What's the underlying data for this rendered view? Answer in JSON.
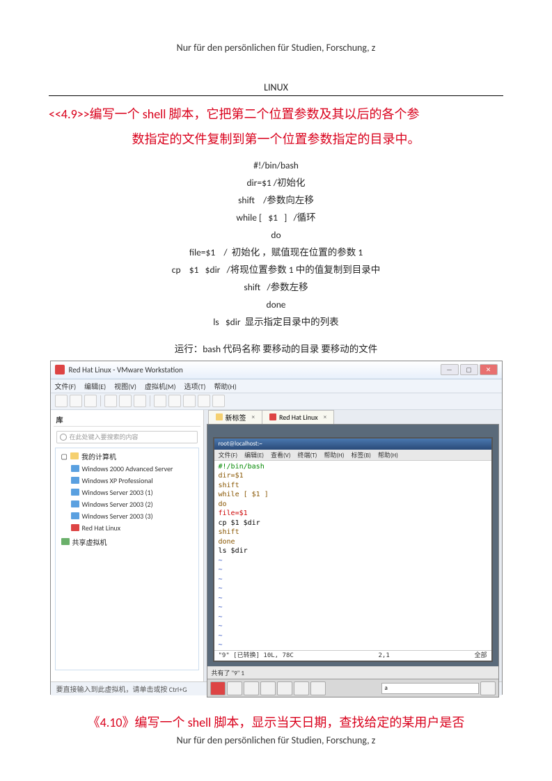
{
  "header": "Nur für den persönlichen für Studien, Forschung, z",
  "section_title": "LINUX",
  "q49_heading_l1": "<<4.9>>编写一个 shell 脚本，它把第二个位置参数及其以后的各个参",
  "q49_heading_l2": "数指定的文件复制到第一个位置参数指定的目录中。",
  "code": {
    "l1": "#!/bin/bash",
    "l2": "dir=$1 /初始化",
    "l3": "shift    /参数向左移",
    "l4": "while [   $1   ]   /循环",
    "l5": "do",
    "l6": "file=$1    /  初始化 ，赋值现在位置的参数 1",
    "l7": "cp    $1   $dir   /将现位置参数 1 中的值复制到目录中",
    "l8": "shift   /参数左移",
    "l9": "done",
    "l10": "ls   $dir  显示指定目录中的列表"
  },
  "run_line": "运行：bash  代码名称    要移动的目录    要移动的文件",
  "vm": {
    "title": "Red Hat Linux - VMware Workstation",
    "menus": [
      "文件(F)",
      "编辑(E)",
      "视图(V)",
      "虚拟机(M)",
      "选项(T)",
      "帮助(H)"
    ],
    "sidebar_head": "库",
    "search_placeholder": "在此处键入要搜索的内容",
    "tree_root": "我的计算机",
    "tree_items": [
      "Windows 2000 Advanced Server",
      "Windows XP Professional",
      "Windows Server 2003 (1)",
      "Windows Server 2003 (2)",
      "Windows Server 2003 (3)",
      "Red Hat Linux"
    ],
    "tree_shared": "共享虚拟机",
    "tabs": [
      {
        "label": "新标签",
        "active": false
      },
      {
        "label": "Red Hat Linux",
        "active": true
      }
    ],
    "guest_title": "root@localhost:~",
    "guest_menus": [
      "文件(F)",
      "编辑(E)",
      "查看(V)",
      "终端(T)",
      "帮助(H)",
      "标签(B)",
      "帮助(H)"
    ],
    "term_lines": [
      {
        "t": "#!/bin/bash",
        "c": "c-green"
      },
      {
        "t": "dir=$1",
        "c": "c-brown"
      },
      {
        "t": "shift",
        "c": "c-brown"
      },
      {
        "t": "while [ $1 ]",
        "c": "c-brown"
      },
      {
        "t": "do",
        "c": "c-brown"
      },
      {
        "t": "file=$1",
        "c": "c-red"
      },
      {
        "t": "cp $1 $dir",
        "c": ""
      },
      {
        "t": "shift",
        "c": "c-brown"
      },
      {
        "t": "done",
        "c": "c-brown"
      },
      {
        "t": "ls $dir",
        "c": ""
      }
    ],
    "term_status_left": "\"9\" [已转换] 10L, 78C",
    "term_status_mid": "2,1",
    "term_status_right": "全部",
    "term_bottom_msg": "共有了 \"9\" 1",
    "taskbar_text": "a",
    "status_left": "要直接输入到此虚拟机，请单击或按 Ctrl+G"
  },
  "q410_heading": "《4.10》编写一个 shell 脚本，显示当天日期，查找给定的某用户是否",
  "footer": "Nur für den persönlichen für Studien, Forschung, z"
}
